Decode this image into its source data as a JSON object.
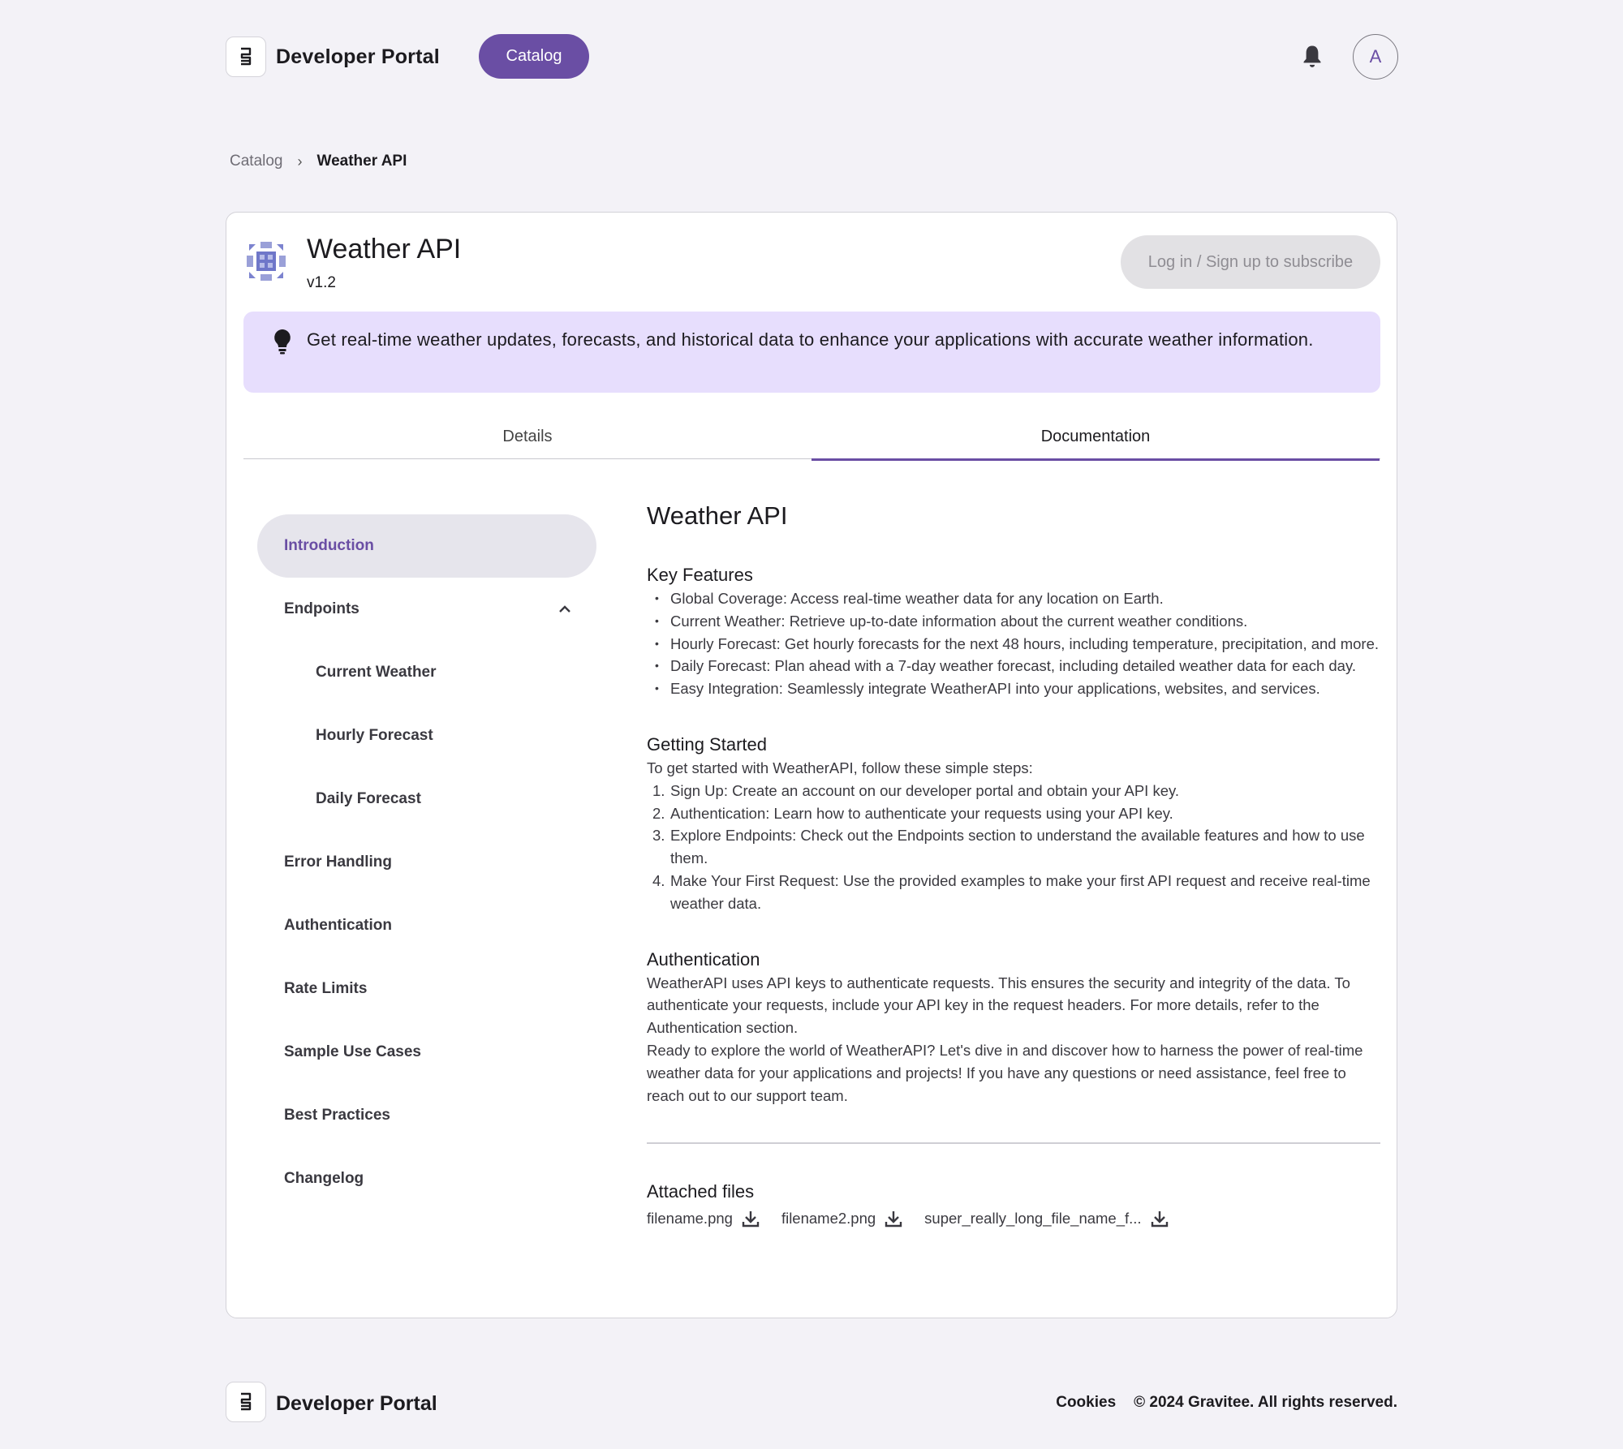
{
  "header": {
    "brand": "Developer Portal",
    "catalog_label": "Catalog",
    "avatar_initial": "A",
    "logo_icon": "portal-logo-icon",
    "notification_icon": "bell-icon"
  },
  "breadcrumb": {
    "items": [
      "Catalog",
      "Weather API"
    ]
  },
  "api": {
    "title": "Weather API",
    "version": "v1.2",
    "subscribe_label": "Log in / Sign up to subscribe",
    "description": "Get real-time weather updates, forecasts, and historical data to enhance your applications with accurate weather information."
  },
  "tabs": [
    {
      "label": "Details",
      "active": false
    },
    {
      "label": "Documentation",
      "active": true
    }
  ],
  "sidenav": [
    {
      "label": "Introduction",
      "active": true
    },
    {
      "label": "Endpoints",
      "expanded": true
    },
    {
      "label": "Current Weather",
      "sub": true
    },
    {
      "label": "Hourly Forecast",
      "sub": true
    },
    {
      "label": "Daily Forecast",
      "sub": true
    },
    {
      "label": "Error Handling"
    },
    {
      "label": "Authentication"
    },
    {
      "label": "Rate Limits"
    },
    {
      "label": "Sample Use Cases"
    },
    {
      "label": "Best Practices"
    },
    {
      "label": "Changelog"
    }
  ],
  "doc": {
    "title": "Weather API",
    "key_features": {
      "heading": "Key Features",
      "items": [
        "Global Coverage: Access real-time weather data for any location on Earth.",
        "Current Weather: Retrieve up-to-date information about the current weather conditions.",
        "Hourly Forecast: Get hourly forecasts for the next 48 hours, including temperature, precipitation, and more.",
        "Daily Forecast: Plan ahead with a 7-day weather forecast, including detailed weather data for each day.",
        "Easy Integration: Seamlessly integrate WeatherAPI into your applications, websites, and services."
      ]
    },
    "getting_started": {
      "heading": "Getting Started",
      "intro": "To get started with WeatherAPI, follow these simple steps:",
      "steps": [
        {
          "num": "1.",
          "text": "Sign Up: Create an account on our developer portal and obtain your API key."
        },
        {
          "num": "2.",
          "text": "Authentication: Learn how to authenticate your requests using your API key."
        },
        {
          "num": "3.",
          "text": "Explore Endpoints: Check out the Endpoints section to understand the available features and how to use them."
        },
        {
          "num": "4.",
          "text": "Make Your First Request: Use the provided examples to make your first API request and receive real-time weather data."
        }
      ]
    },
    "authentication": {
      "heading": "Authentication",
      "p1": "WeatherAPI uses API keys to authenticate requests. This ensures the security and integrity of the data. To authenticate your requests, include your API key in the request headers. For more details, refer to the Authentication section.",
      "p2": "Ready to explore the world of WeatherAPI? Let's dive in and discover how to harness the power of real-time weather data for your applications and projects! If you have any questions or need assistance, feel free to reach out to our support team."
    },
    "files": {
      "heading": "Attached files",
      "items": [
        "filename.png",
        "filename2.png",
        "super_really_long_file_name_f..."
      ]
    }
  },
  "footer": {
    "brand": "Developer Portal",
    "cookies": "Cookies",
    "copyright": "© 2024 Gravitee. All rights reserved."
  },
  "colors": {
    "accent": "#6a4ea4",
    "banner_bg": "#e7defd",
    "page_bg": "#f3f2f7"
  }
}
